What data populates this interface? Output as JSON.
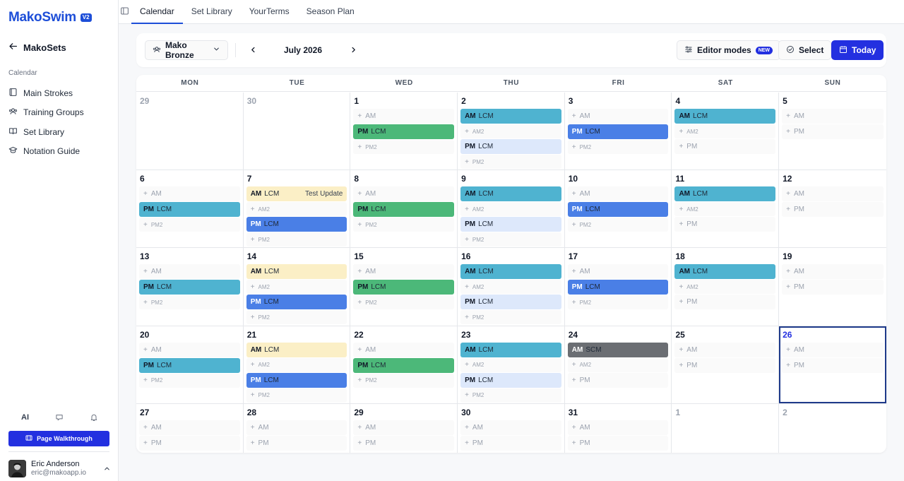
{
  "app": {
    "name": "MakoSwim",
    "version": "V2"
  },
  "sidebar": {
    "back_label": "MakoSets",
    "section_label": "Calendar",
    "items": [
      {
        "label": "Main Strokes",
        "icon": "book-icon"
      },
      {
        "label": "Training Groups",
        "icon": "users-icon"
      },
      {
        "label": "Set Library",
        "icon": "open-book-icon"
      },
      {
        "label": "Notation Guide",
        "icon": "graduation-cap-icon"
      }
    ],
    "ai_label": "AI",
    "walkthrough_label": "Page Walkthrough",
    "user": {
      "name": "Eric Anderson",
      "email": "eric@makoapp.io"
    }
  },
  "tabs": [
    {
      "label": "Calendar",
      "active": true
    },
    {
      "label": "Set Library",
      "active": false
    },
    {
      "label": "YourTerms",
      "active": false
    },
    {
      "label": "Season Plan",
      "active": false
    }
  ],
  "toolbar": {
    "group": "Mako Bronze",
    "month": "July 2026",
    "editor_label": "Editor modes",
    "new_badge": "NEW",
    "select_label": "Select",
    "today_label": "Today"
  },
  "colors": {
    "accent": "#2330e0",
    "cyan": "#4fb3d0",
    "green": "#4cb879",
    "blue": "#4a7fe6",
    "light_blue": "#dde8fb",
    "yellow": "#fbefc6",
    "gray": "#6b6e73"
  },
  "calendar": {
    "weekdays": [
      "MON",
      "TUE",
      "WED",
      "THU",
      "FRI",
      "SAT",
      "SUN"
    ],
    "weeks": [
      [
        {
          "day": "29",
          "muted": true,
          "slots": []
        },
        {
          "day": "30",
          "muted": true,
          "slots": []
        },
        {
          "day": "1",
          "slots": [
            {
              "label": "AM"
            },
            {
              "label": "PM",
              "tag": "LCM",
              "color": "green"
            },
            {
              "label": "PM2",
              "small": true
            }
          ]
        },
        {
          "day": "2",
          "slots": [
            {
              "label": "AM",
              "tag": "LCM",
              "color": "cyan"
            },
            {
              "label": "AM2",
              "small": true
            },
            {
              "label": "PM",
              "tag": "LCM",
              "color": "lightblue"
            },
            {
              "label": "PM2",
              "small": true
            }
          ]
        },
        {
          "day": "3",
          "slots": [
            {
              "label": "AM"
            },
            {
              "label": "PM",
              "tag": "LCM",
              "color": "blue"
            },
            {
              "label": "PM2",
              "small": true
            }
          ]
        },
        {
          "day": "4",
          "slots": [
            {
              "label": "AM",
              "tag": "LCM",
              "color": "cyan"
            },
            {
              "label": "AM2",
              "small": true
            },
            {
              "label": "PM"
            }
          ]
        },
        {
          "day": "5",
          "slots": [
            {
              "label": "AM"
            },
            {
              "label": "PM"
            }
          ]
        }
      ],
      [
        {
          "day": "6",
          "slots": [
            {
              "label": "AM"
            },
            {
              "label": "PM",
              "tag": "LCM",
              "color": "cyan"
            },
            {
              "label": "PM2",
              "small": true
            }
          ]
        },
        {
          "day": "7",
          "slots": [
            {
              "label": "AM",
              "tag": "LCM",
              "color": "yellow",
              "note": "Test Update"
            },
            {
              "label": "AM2",
              "small": true
            },
            {
              "label": "PM",
              "tag": "LCM",
              "color": "blue"
            },
            {
              "label": "PM2",
              "small": true
            }
          ]
        },
        {
          "day": "8",
          "slots": [
            {
              "label": "AM"
            },
            {
              "label": "PM",
              "tag": "LCM",
              "color": "green"
            },
            {
              "label": "PM2",
              "small": true
            }
          ]
        },
        {
          "day": "9",
          "slots": [
            {
              "label": "AM",
              "tag": "LCM",
              "color": "cyan"
            },
            {
              "label": "AM2",
              "small": true
            },
            {
              "label": "PM",
              "tag": "LCM",
              "color": "lightblue"
            },
            {
              "label": "PM2",
              "small": true
            }
          ]
        },
        {
          "day": "10",
          "slots": [
            {
              "label": "AM"
            },
            {
              "label": "PM",
              "tag": "LCM",
              "color": "blue"
            },
            {
              "label": "PM2",
              "small": true
            }
          ]
        },
        {
          "day": "11",
          "slots": [
            {
              "label": "AM",
              "tag": "LCM",
              "color": "cyan"
            },
            {
              "label": "AM2",
              "small": true
            },
            {
              "label": "PM"
            }
          ]
        },
        {
          "day": "12",
          "slots": [
            {
              "label": "AM"
            },
            {
              "label": "PM"
            }
          ]
        }
      ],
      [
        {
          "day": "13",
          "slots": [
            {
              "label": "AM"
            },
            {
              "label": "PM",
              "tag": "LCM",
              "color": "cyan"
            },
            {
              "label": "PM2",
              "small": true
            }
          ]
        },
        {
          "day": "14",
          "slots": [
            {
              "label": "AM",
              "tag": "LCM",
              "color": "yellow"
            },
            {
              "label": "AM2",
              "small": true
            },
            {
              "label": "PM",
              "tag": "LCM",
              "color": "blue"
            },
            {
              "label": "PM2",
              "small": true
            }
          ]
        },
        {
          "day": "15",
          "slots": [
            {
              "label": "AM"
            },
            {
              "label": "PM",
              "tag": "LCM",
              "color": "green"
            },
            {
              "label": "PM2",
              "small": true
            }
          ]
        },
        {
          "day": "16",
          "slots": [
            {
              "label": "AM",
              "tag": "LCM",
              "color": "cyan"
            },
            {
              "label": "AM2",
              "small": true
            },
            {
              "label": "PM",
              "tag": "LCM",
              "color": "lightblue"
            },
            {
              "label": "PM2",
              "small": true
            }
          ]
        },
        {
          "day": "17",
          "slots": [
            {
              "label": "AM"
            },
            {
              "label": "PM",
              "tag": "LCM",
              "color": "blue"
            },
            {
              "label": "PM2",
              "small": true
            }
          ]
        },
        {
          "day": "18",
          "slots": [
            {
              "label": "AM",
              "tag": "LCM",
              "color": "cyan"
            },
            {
              "label": "AM2",
              "small": true
            },
            {
              "label": "PM"
            }
          ]
        },
        {
          "day": "19",
          "slots": [
            {
              "label": "AM"
            },
            {
              "label": "PM"
            }
          ]
        }
      ],
      [
        {
          "day": "20",
          "slots": [
            {
              "label": "AM"
            },
            {
              "label": "PM",
              "tag": "LCM",
              "color": "cyan"
            },
            {
              "label": "PM2",
              "small": true
            }
          ]
        },
        {
          "day": "21",
          "slots": [
            {
              "label": "AM",
              "tag": "LCM",
              "color": "yellow"
            },
            {
              "label": "AM2",
              "small": true
            },
            {
              "label": "PM",
              "tag": "LCM",
              "color": "blue"
            },
            {
              "label": "PM2",
              "small": true
            }
          ]
        },
        {
          "day": "22",
          "slots": [
            {
              "label": "AM"
            },
            {
              "label": "PM",
              "tag": "LCM",
              "color": "green"
            },
            {
              "label": "PM2",
              "small": true
            }
          ]
        },
        {
          "day": "23",
          "slots": [
            {
              "label": "AM",
              "tag": "LCM",
              "color": "cyan"
            },
            {
              "label": "AM2",
              "small": true
            },
            {
              "label": "PM",
              "tag": "LCM",
              "color": "lightblue"
            },
            {
              "label": "PM2",
              "small": true
            }
          ]
        },
        {
          "day": "24",
          "slots": [
            {
              "label": "AM",
              "tag": "SCM",
              "color": "gray"
            },
            {
              "label": "AM2",
              "small": true
            },
            {
              "label": "PM"
            }
          ]
        },
        {
          "day": "25",
          "slots": [
            {
              "label": "AM"
            },
            {
              "label": "PM"
            }
          ]
        },
        {
          "day": "26",
          "today": true,
          "slots": [
            {
              "label": "AM"
            },
            {
              "label": "PM"
            }
          ]
        }
      ],
      [
        {
          "day": "27",
          "slots": [
            {
              "label": "AM"
            },
            {
              "label": "PM"
            }
          ]
        },
        {
          "day": "28",
          "slots": [
            {
              "label": "AM"
            },
            {
              "label": "PM"
            }
          ]
        },
        {
          "day": "29",
          "slots": [
            {
              "label": "AM"
            },
            {
              "label": "PM"
            }
          ]
        },
        {
          "day": "30",
          "slots": [
            {
              "label": "AM"
            },
            {
              "label": "PM"
            }
          ]
        },
        {
          "day": "31",
          "slots": [
            {
              "label": "AM"
            },
            {
              "label": "PM"
            }
          ]
        },
        {
          "day": "1",
          "muted": true,
          "slots": []
        },
        {
          "day": "2",
          "muted": true,
          "slots": []
        }
      ]
    ]
  }
}
